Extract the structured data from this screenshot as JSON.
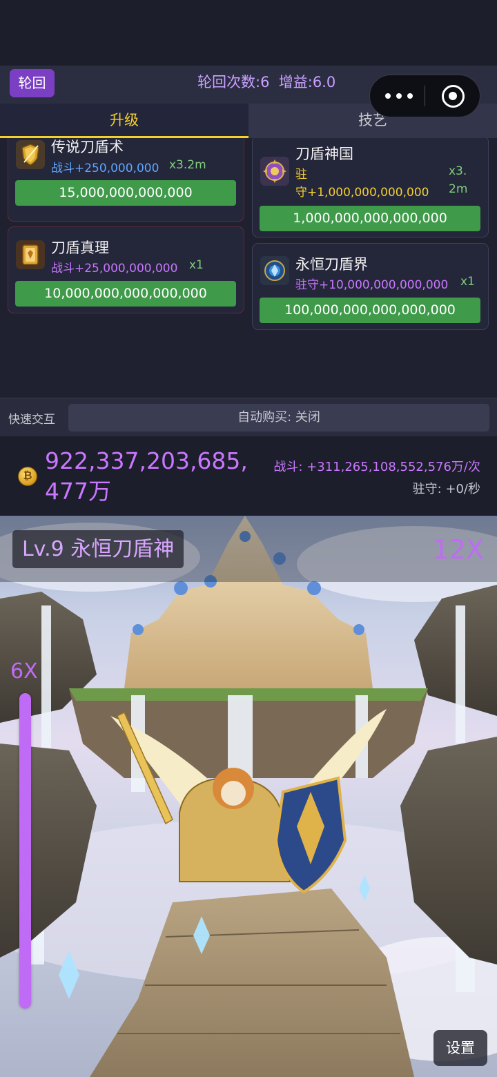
{
  "header": {
    "rebirth_button": "轮回",
    "rebirth_info": "轮回次数:6  增益:6.0"
  },
  "tabs": [
    {
      "label": "升级",
      "active": true
    },
    {
      "label": "技艺",
      "active": false
    }
  ],
  "upgrades_left": [
    {
      "name": "传说刀盾术",
      "stat": "战斗+250,000,000",
      "mult": "x3.2m",
      "price": "15,000,000,000,000",
      "icon": "golden-shield-sword-icon"
    },
    {
      "name": "刀盾真理",
      "stat": "战斗+25,000,000,000",
      "mult": "x1",
      "price": "10,000,000,000,000,000",
      "icon": "golden-scroll-icon"
    }
  ],
  "upgrades_right": [
    {
      "name": "刀盾神国",
      "stat_line1": "驻",
      "stat_line2": "守+1,000,000,000,000",
      "mult_line1": "x3.",
      "mult_line2": "2m",
      "price": "1,000,000,000,000,000",
      "icon": "sacred-emblem-icon"
    },
    {
      "name": "永恒刀盾界",
      "stat": "驻守+10,000,000,000,000",
      "mult": "x1",
      "price": "100,000,000,000,000,000",
      "icon": "blue-realm-emblem-icon"
    }
  ],
  "quick": {
    "label": "快速交互",
    "auto_buy": "自动购买: 关闭"
  },
  "gold": {
    "amount": "922,337,203,685,477万",
    "attack_rate": "战斗: +311,265,108,552,576万/次",
    "guard_rate": "驻守: +0/秒"
  },
  "scene": {
    "level": "Lv.9 永恒刀盾神",
    "multiplier_top": "12X",
    "multiplier_side": "6X",
    "power_level": 1.0,
    "settings": "设置"
  },
  "colors": {
    "accent_purple": "#c977ff",
    "tab_active": "#f5cf2e",
    "buy_green": "#3f9a4a",
    "stat_blue": "#5fa6ff"
  }
}
